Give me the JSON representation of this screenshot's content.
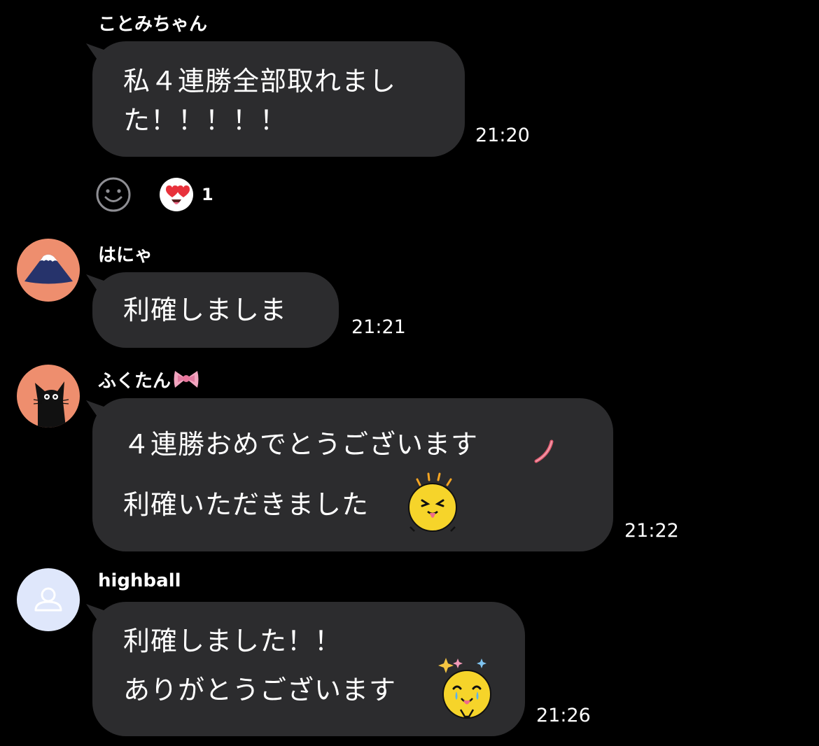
{
  "messages": [
    {
      "sender": "ことみちゃん",
      "lines": [
        "私４連勝全部取れまし",
        "た！！！！！"
      ],
      "time": "21:20",
      "reaction": {
        "icon": "heart-eyes-sticker-icon",
        "count": "1"
      }
    },
    {
      "sender": "はにゃ",
      "lines": [
        "利確しましま"
      ],
      "time": "21:21",
      "avatar_icon": "mountain-avatar-icon"
    },
    {
      "sender": "ふくたん",
      "sender_icon": "ribbon-icon",
      "lines": [
        "４連勝おめでとうございます",
        "利確いただきました"
      ],
      "time": "21:22",
      "avatar_icon": "black-cat-avatar-icon",
      "inline_icons": [
        "stroke-emoji-icon",
        "excited-face-sticker-icon"
      ]
    },
    {
      "sender": "highball",
      "lines": [
        "利確しました！！",
        "ありがとうございます"
      ],
      "time": "21:26",
      "avatar_icon": "default-person-avatar-icon",
      "inline_icons": [
        "crying-face-sticker-icon"
      ]
    }
  ],
  "colors": {
    "background": "#000000",
    "bubble": "#2c2c2e",
    "avatar_mountain_bg": "#ee8e6e",
    "avatar_cat_bg": "#ee8e6e",
    "avatar_default_bg": "#dfe7fb"
  }
}
